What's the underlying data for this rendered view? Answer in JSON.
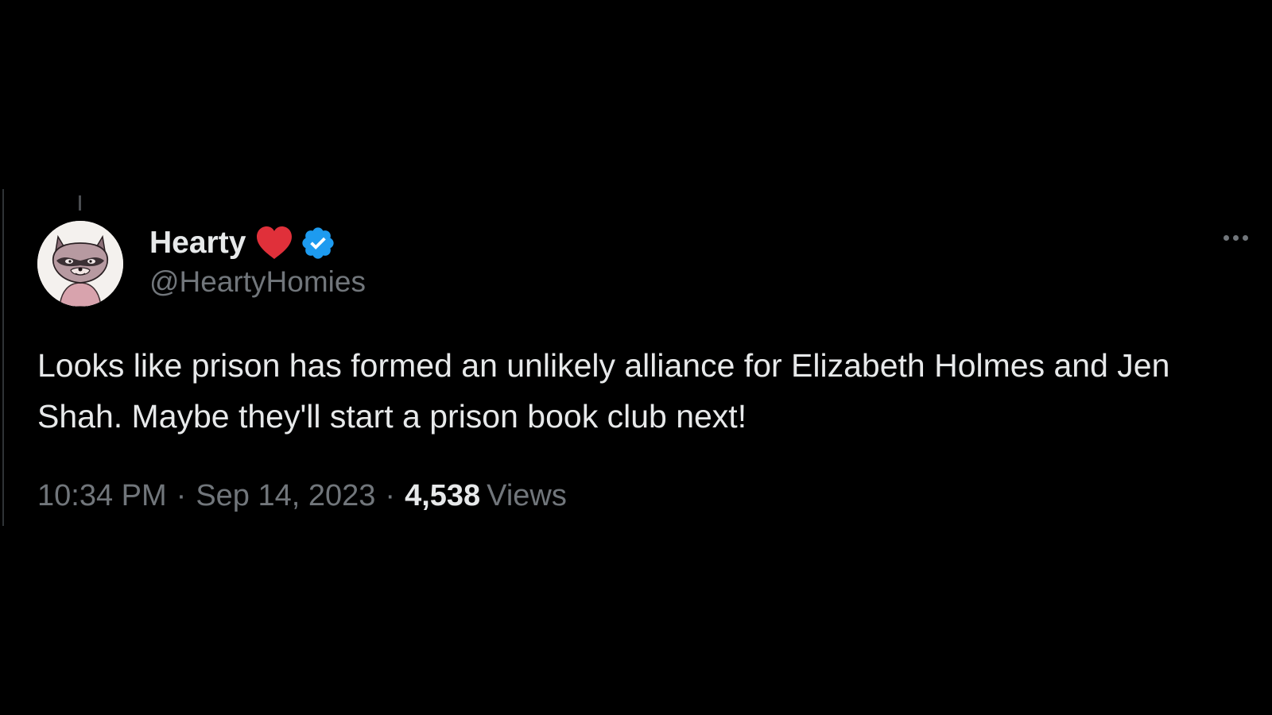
{
  "tweet": {
    "author": {
      "display_name": "Hearty",
      "handle": "@HeartyHomies",
      "badge_icons": [
        "red-heart-icon",
        "verified-badge-icon"
      ],
      "verified_color": "#1d9bf0",
      "heart_color": "#e0303a"
    },
    "text": "Looks like prison has formed an unlikely alliance for Elizabeth Holmes and Jen Shah. Maybe they'll start a prison book club next!",
    "time": "10:34 PM",
    "separator": "·",
    "date": "Sep 14, 2023",
    "views_count": "4,538",
    "views_label": "Views",
    "more_icon": "more-horizontal-icon"
  },
  "theme": {
    "background": "#000000",
    "primary_text": "#e7e9ea",
    "secondary_text": "#71767b"
  }
}
